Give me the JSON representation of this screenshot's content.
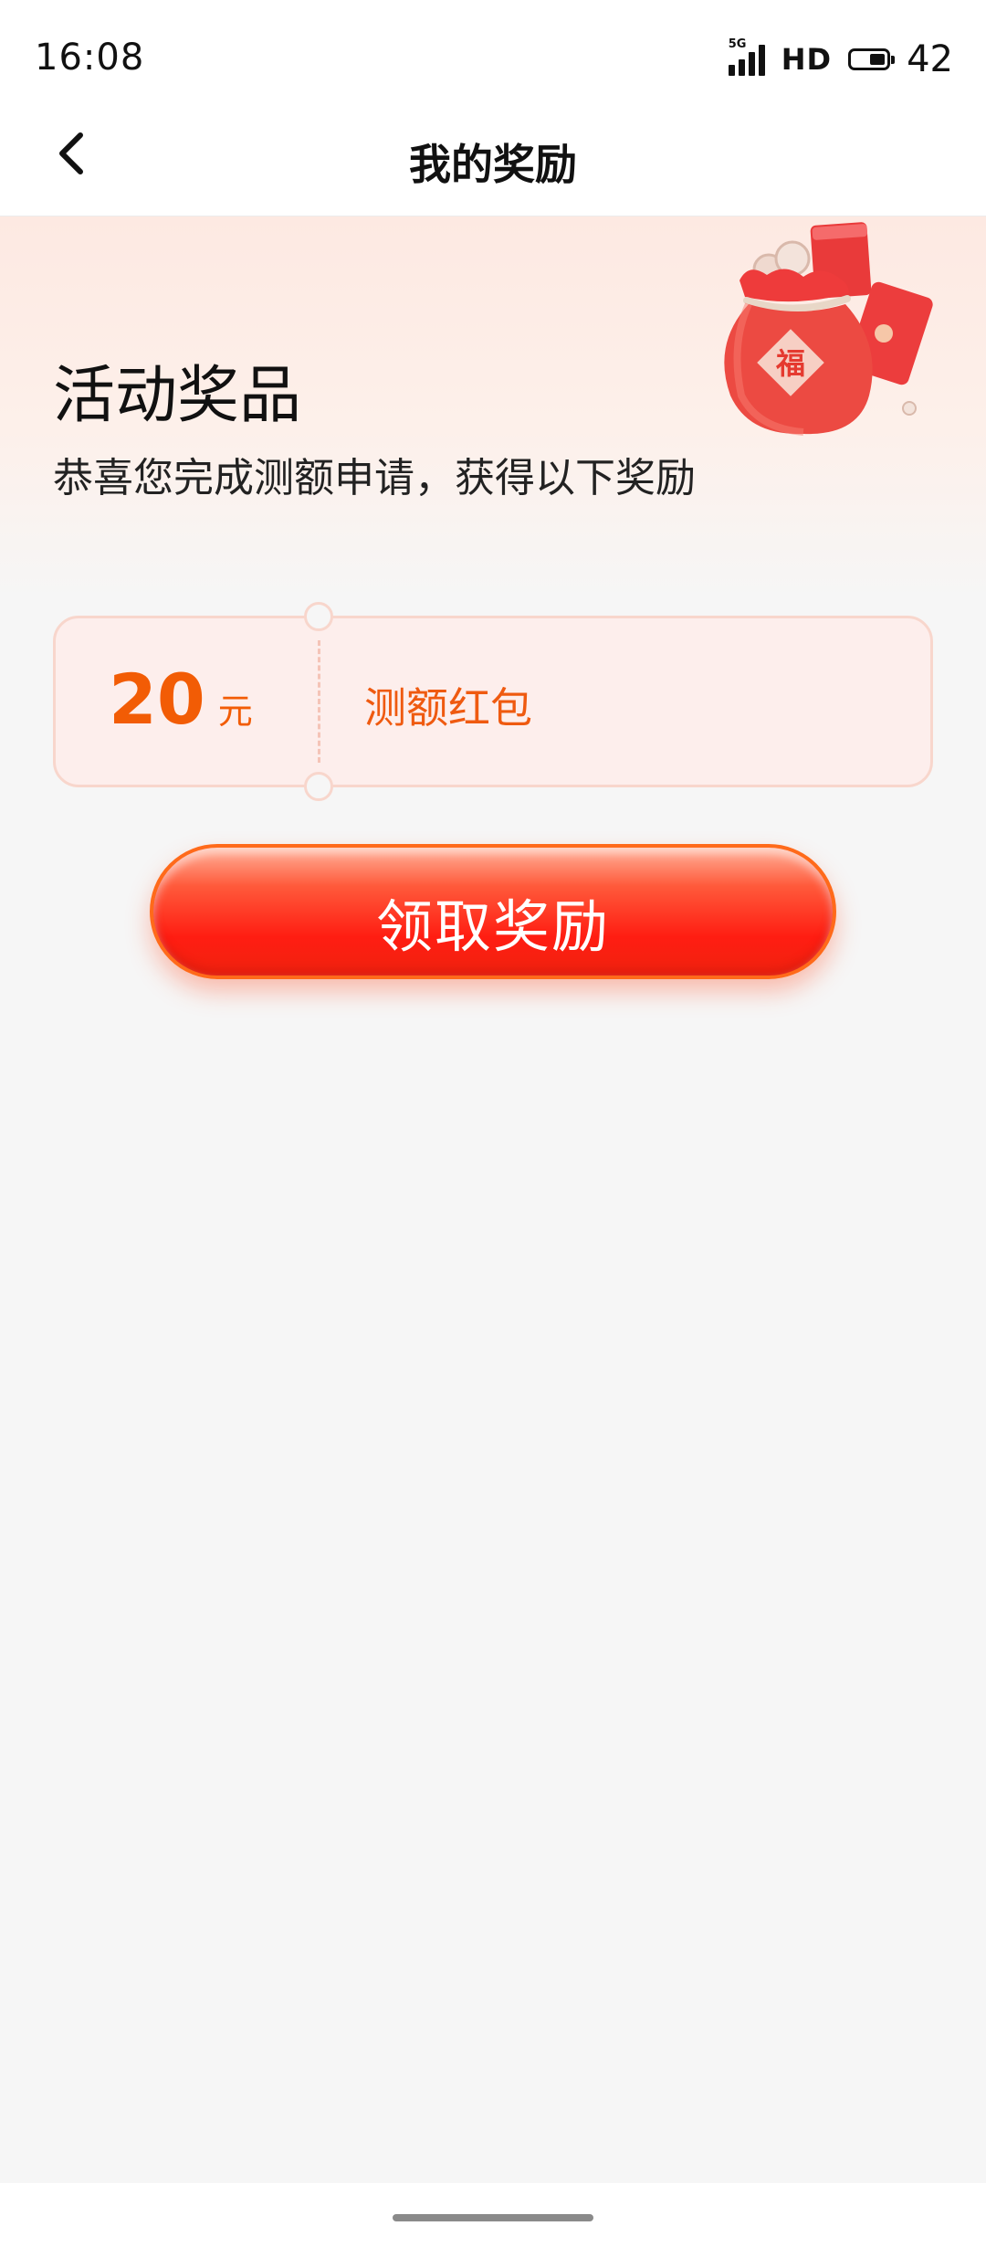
{
  "status_bar": {
    "time": "16:08",
    "network": "5G",
    "hd": "HD",
    "battery_level": "42"
  },
  "nav": {
    "title": "我的奖励"
  },
  "hero": {
    "title": "活动奖品",
    "subtitle": "恭喜您完成测额申请，获得以下奖励",
    "bag_character": "福"
  },
  "reward": {
    "amount": "20",
    "unit": "元",
    "name": "测额红包"
  },
  "claim_button": {
    "label": "领取奖励"
  },
  "colors": {
    "accent_orange": "#f25c05",
    "button_red": "#ff1d12",
    "card_bg": "#fdeeec",
    "hero_bg": "#fde9e2"
  }
}
